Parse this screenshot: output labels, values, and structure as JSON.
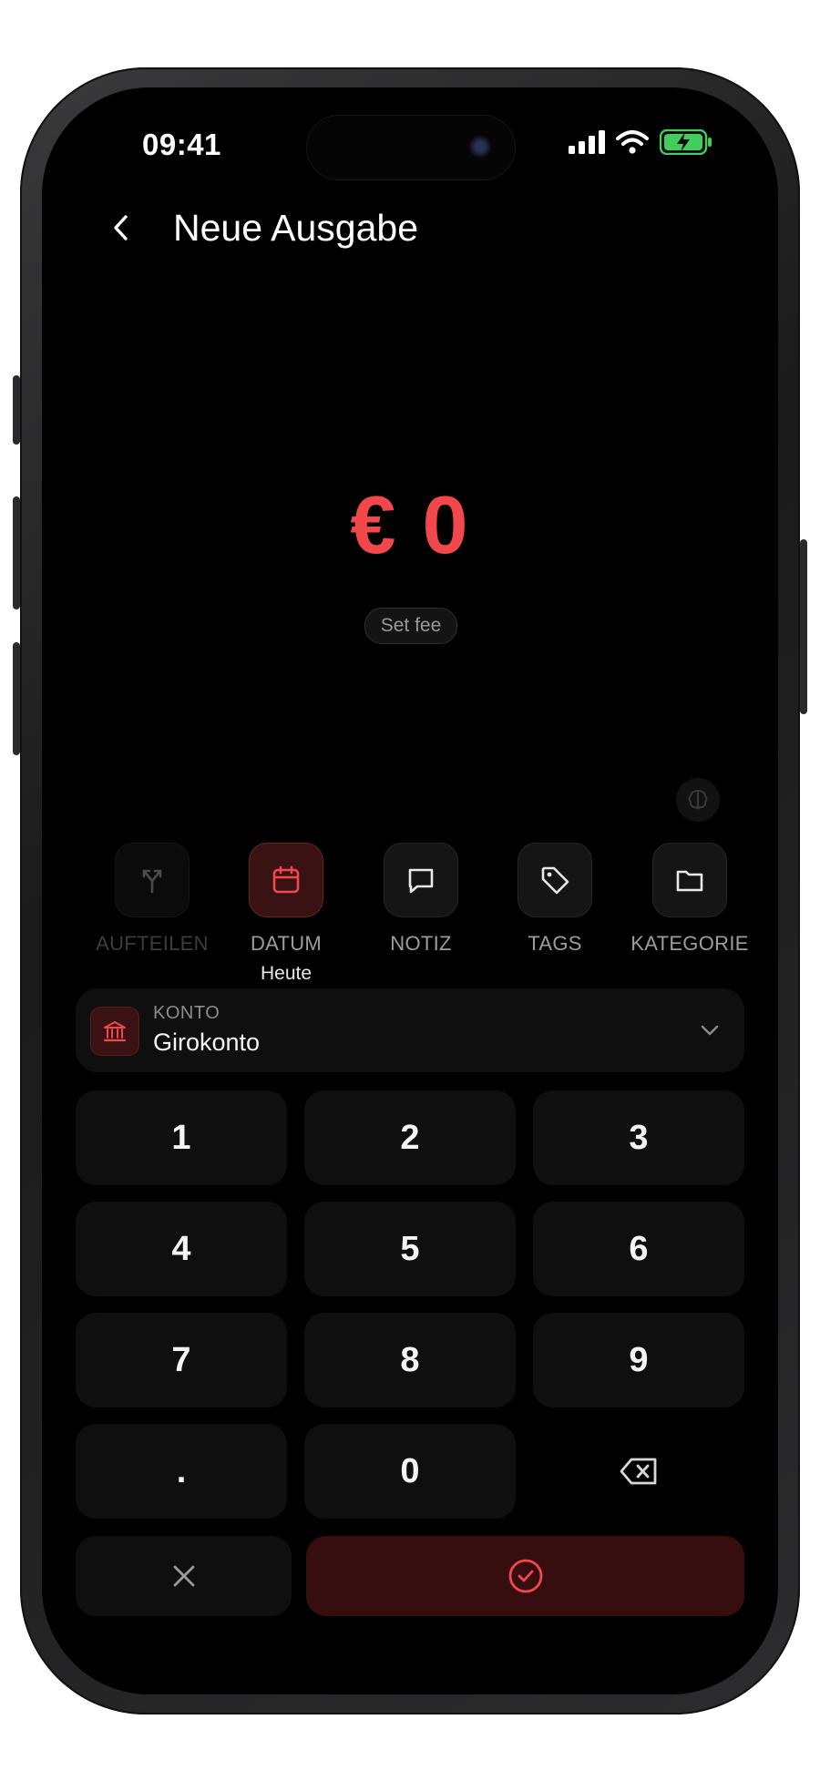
{
  "status_bar": {
    "time": "09:41"
  },
  "header": {
    "title": "Neue Ausgabe"
  },
  "amount": {
    "currency": "€",
    "value": "0",
    "fee_label": "Set fee"
  },
  "actions": [
    {
      "id": "split",
      "label": "AUFTEILEN",
      "icon": "split-icon",
      "state": "disabled"
    },
    {
      "id": "date",
      "label": "DATUM",
      "icon": "calendar-icon",
      "state": "active",
      "sub": "Heute"
    },
    {
      "id": "note",
      "label": "NOTIZ",
      "icon": "chat-bubble-icon",
      "state": "normal"
    },
    {
      "id": "tags",
      "label": "TAGS",
      "icon": "tag-icon",
      "state": "normal"
    },
    {
      "id": "category",
      "label": "KATEGORIE",
      "icon": "folder-icon",
      "state": "normal"
    }
  ],
  "account": {
    "caption": "KONTO",
    "value": "Girokonto"
  },
  "keypad": {
    "keys": [
      "1",
      "2",
      "3",
      "4",
      "5",
      "6",
      "7",
      "8",
      "9",
      ".",
      "0"
    ]
  },
  "colors": {
    "accent": "#f2484b",
    "accent_dark": "#360e10",
    "background": "#000000",
    "surface": "#0f0f0f"
  }
}
